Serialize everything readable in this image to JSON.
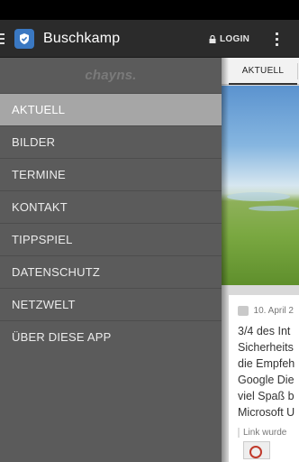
{
  "action_bar": {
    "title": "Buschkamp",
    "login_label": "LOGIN"
  },
  "drawer": {
    "logo": "chayns.",
    "items": [
      {
        "label": "AKTUELL",
        "active": true
      },
      {
        "label": "BILDER",
        "active": false
      },
      {
        "label": "TERMINE",
        "active": false
      },
      {
        "label": "KONTAKT",
        "active": false
      },
      {
        "label": "TIPPSPIEL",
        "active": false
      },
      {
        "label": "DATENSCHUTZ",
        "active": false
      },
      {
        "label": "NETZWELT",
        "active": false
      },
      {
        "label": "ÜBER DIESE APP",
        "active": false
      }
    ]
  },
  "content": {
    "tab_label": "AKTUELL",
    "card": {
      "date": "10. April 2",
      "lines": [
        "3/4 des Int",
        "Sicherheits",
        "die Empfeh",
        "Google Die",
        "viel Spaß b",
        "Microsoft U"
      ],
      "link_label": "Link wurde"
    }
  },
  "colors": {
    "drawer_bg": "#5b5b5b",
    "active_item_bg": "#a6a6a6",
    "action_bar_bg": "#2b2b2b"
  },
  "icons": {
    "drawer_toggle": "menu-icon",
    "app_icon": "shield-check-icon",
    "login_icon": "lock-icon",
    "overflow": "more-vertical-icon",
    "comment": "comment-icon"
  }
}
